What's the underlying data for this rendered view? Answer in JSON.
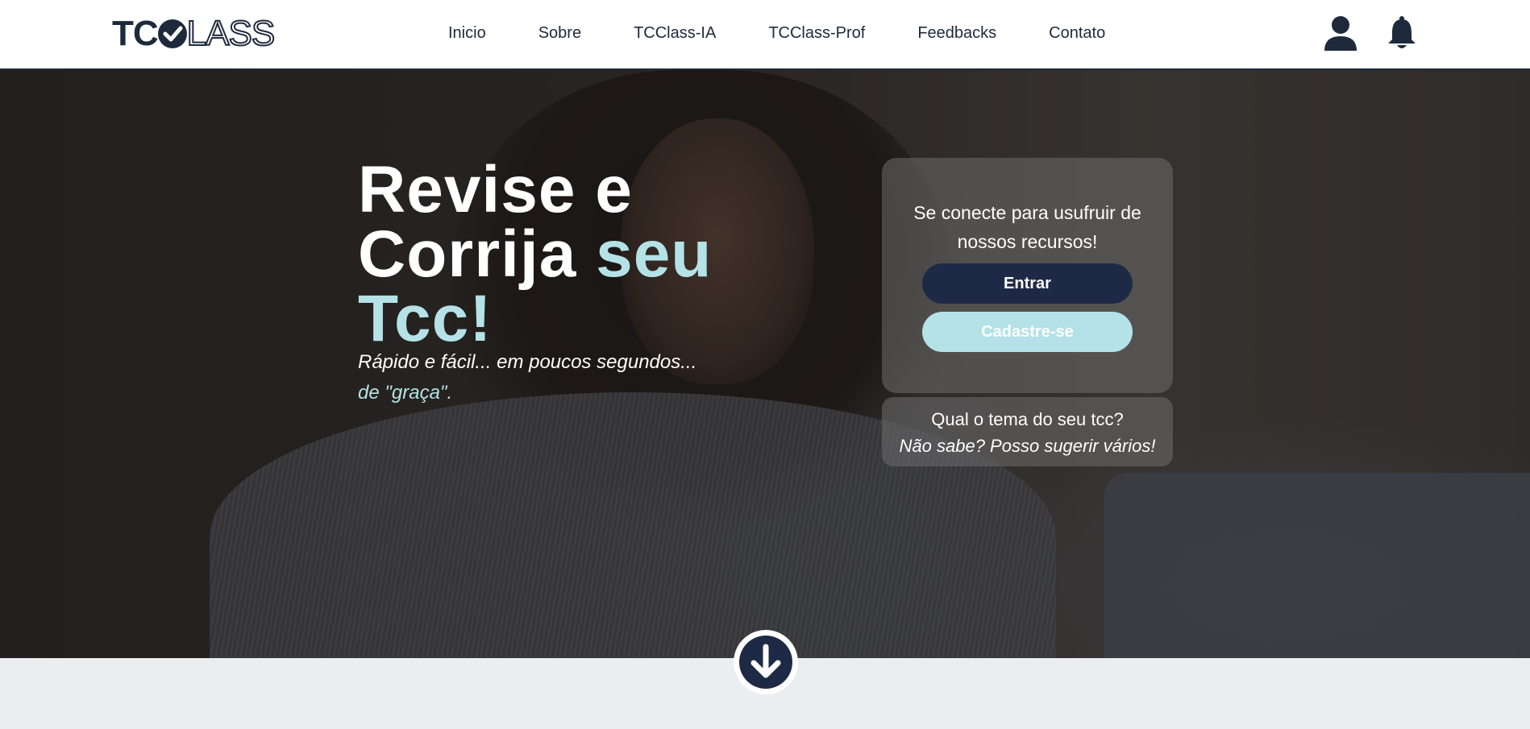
{
  "brand": {
    "logo_left": "TC",
    "logo_right": "LASS",
    "logo_color": "#1e2a3c"
  },
  "nav": {
    "items": [
      {
        "label": "Inicio"
      },
      {
        "label": "Sobre"
      },
      {
        "label": "TCClass-IA"
      },
      {
        "label": "TCClass-Prof"
      },
      {
        "label": "Feedbacks"
      },
      {
        "label": "Contato"
      }
    ]
  },
  "header_icons": {
    "user": "user-icon",
    "notifications": "bell-icon"
  },
  "hero": {
    "title_line1": "Revise e",
    "title_line2_white": "Corrija ",
    "title_line2_accent": "seu",
    "title_line3_accent": "Tcc!",
    "subtitle": "Rápido e fácil... em poucos segundos...",
    "subtitle_accent": "de \"graça\".",
    "accent_color": "#b4e2e6"
  },
  "login_card": {
    "message": "Se conecte para usufruir de nossos recursos!",
    "login_button": "Entrar",
    "signup_button": "Cadastre-se"
  },
  "topic_card": {
    "question": "Qual o tema do seu tcc?",
    "suggestion": "Não sabe? Posso sugerir vários!"
  },
  "scroll_down": {
    "icon": "arrow-down-icon"
  },
  "colors": {
    "navy": "#1e2a45",
    "light_teal": "#b4e2e6",
    "page_bg": "#ebeef1"
  }
}
